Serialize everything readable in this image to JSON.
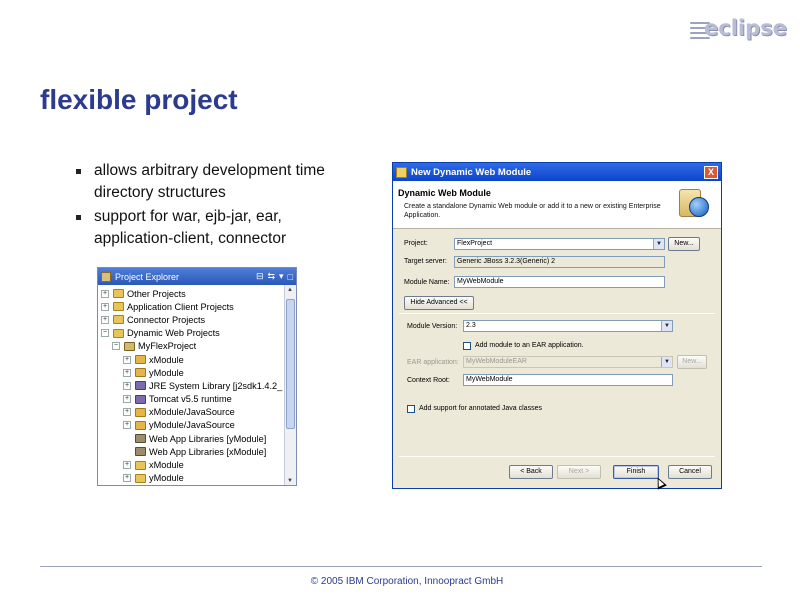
{
  "logo": {
    "word": "eclipse"
  },
  "slide": {
    "title": "flexible project",
    "bullets": [
      "allows arbitrary development time directory structures",
      "support for war, ejb-jar, ear, application-client, connector"
    ],
    "footer": "© 2005 IBM Corporation, Innoopract GmbH"
  },
  "explorer": {
    "title": "Project Explorer",
    "toolbar": [
      "⊟",
      "⇆",
      "▾",
      "□"
    ],
    "items": [
      {
        "label": "Other Projects",
        "exp": "+",
        "icon": "folder"
      },
      {
        "label": "Application Client Projects",
        "exp": "+",
        "icon": "folder"
      },
      {
        "label": "Connector Projects",
        "exp": "+",
        "icon": "folder"
      },
      {
        "label": "Dynamic Web Projects",
        "exp": "−",
        "icon": "folder"
      },
      {
        "label": "MyFlexProject",
        "exp": "−",
        "icon": "proj"
      },
      {
        "label": "xModule",
        "exp": "+",
        "icon": "pkg"
      },
      {
        "label": "yModule",
        "exp": "+",
        "icon": "pkg"
      },
      {
        "label": "JRE System Library [j2sdk1.4.2_",
        "exp": "+",
        "icon": "lib"
      },
      {
        "label": "Tomcat v5.5 runtime",
        "exp": "+",
        "icon": "lib"
      },
      {
        "label": "xModule/JavaSource",
        "exp": "+",
        "icon": "pkg"
      },
      {
        "label": "yModule/JavaSource",
        "exp": "+",
        "icon": "pkg"
      },
      {
        "label": "Web App Libraries [yModule]",
        "exp": "",
        "icon": "jar"
      },
      {
        "label": "Web App Libraries [xModule]",
        "exp": "",
        "icon": "jar"
      },
      {
        "label": "xModule",
        "exp": "+",
        "icon": "folder"
      },
      {
        "label": "yModule",
        "exp": "+",
        "icon": "folder"
      }
    ]
  },
  "dialog": {
    "title": "New Dynamic Web Module",
    "close_label": "X",
    "heading": "Dynamic Web Module",
    "description": "Create a standalone Dynamic Web module or add it to a new or existing Enterprise Application.",
    "project_label": "Project:",
    "project_value": "FlexProject",
    "project_new": "New...",
    "target_label": "Target server:",
    "target_value": "Generic JBoss 3.2.3(Generic) 2",
    "module_name_label": "Module Name:",
    "module_name_value": "MyWebModule",
    "hide_advanced": "Hide Advanced <<",
    "version_label": "Module Version:",
    "version_value": "2.3",
    "add_ear_label": "Add module to an EAR application.",
    "ear_label": "EAR application:",
    "ear_value": "MyWebModuleEAR",
    "ear_new": "New...",
    "context_label": "Context Root:",
    "context_value": "MyWebModule",
    "annotated_label": "Add support for annotated Java classes",
    "back": "< Back",
    "next": "Next >",
    "finish": "Finish",
    "cancel": "Cancel"
  }
}
